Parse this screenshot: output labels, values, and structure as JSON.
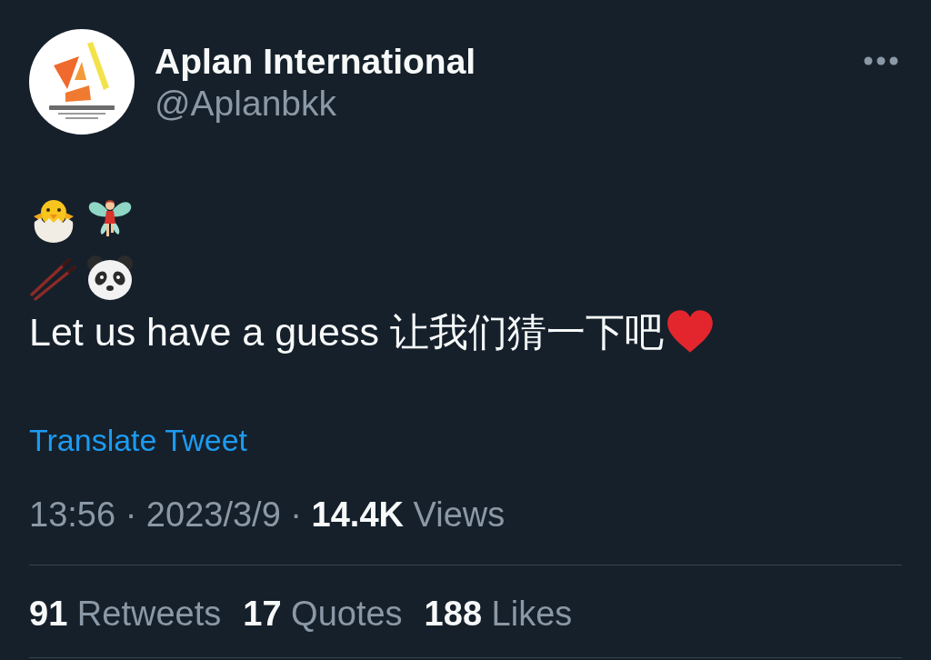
{
  "author": {
    "name": "Aplan International",
    "handle": "@Aplanbkk"
  },
  "tweet": {
    "text": "Let us have a guess 让我们猜一下吧"
  },
  "translate_link": "Translate Tweet",
  "meta": "13:56 · 2023/3/9 · **14.4K** Views",
  "stats": [
    {
      "count": "91",
      "label": "Retweets"
    },
    {
      "count": "17",
      "label": "Quotes"
    },
    {
      "count": "188",
      "label": "Likes"
    }
  ]
}
